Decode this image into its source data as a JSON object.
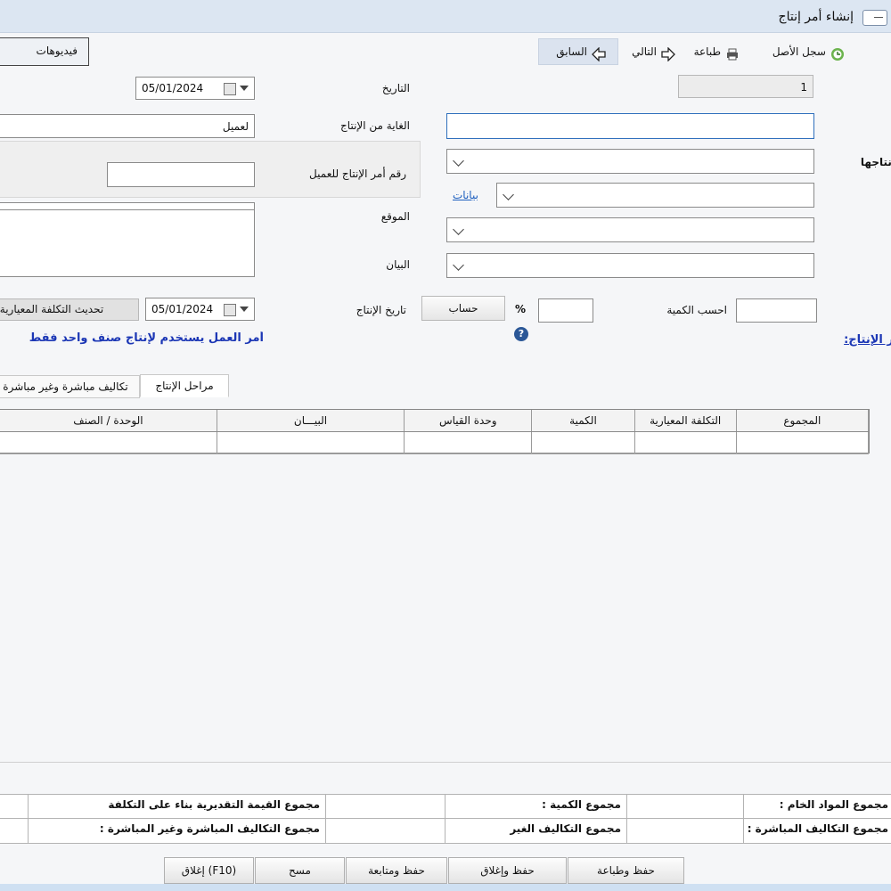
{
  "window": {
    "title": "إنشاء أمر إنتاج"
  },
  "video_button": "فيديوهات",
  "toolbar": {
    "history": "سجل الأصل",
    "print": "طباعة",
    "next": "التالي",
    "previous": "السابق"
  },
  "form": {
    "number_value": "1",
    "date_label": "التاريخ",
    "date_value": "05/01/2024",
    "purpose_label": "الغاية من الإنتاج",
    "purpose_value": "لعميل",
    "customer_order_label": "رقم أمر الإنتاج للعميل",
    "location_label": "الموقع",
    "description_label": "البيان",
    "right_label_products": "إنتاجها",
    "data_link": "بيانات",
    "calc_qty_label": "احسب الكمية",
    "percent_sign": "%",
    "calc_button": "حساب",
    "production_date_label": "تاريخ الإنتاج",
    "production_date_value": "05/01/2024",
    "update_cost_button": "تحديث التكلفة المعيارية",
    "info_text": "أمر العمل يستخدم لإنتاج صنف واحد فقط",
    "production_order_link": "أمر الإنتاج:"
  },
  "tabs": [
    {
      "label": "مراحل الإنتاج"
    },
    {
      "label": "تكاليف مباشرة وغير مباشرة"
    }
  ],
  "grid": {
    "columns": [
      "المجموع",
      "التكلفة المعيارية",
      "الكمية",
      "وحدة القياس",
      "البيـــان",
      "الوحدة / الصنف"
    ]
  },
  "summary": {
    "raw_total_label": "مجموع المواد الخام :",
    "qty_total_label": "مجموع الكمية :",
    "estimated_value_label": "مجموع القيمة التقديرية بناء على التكلفة",
    "direct_costs_label": "مجموع التكاليف المباشرة :",
    "indirect_costs_label": "مجموع التكاليف الغير",
    "all_costs_label": "مجموع التكاليف المباشرة وغير المباشرة :"
  },
  "footer": {
    "save_print": "حفظ وطباعة",
    "save_close": "حفظ وإغلاق",
    "save_continue": "حفظ ومتابعة",
    "clear": "مسح",
    "close": "إغلاق (F10)"
  }
}
